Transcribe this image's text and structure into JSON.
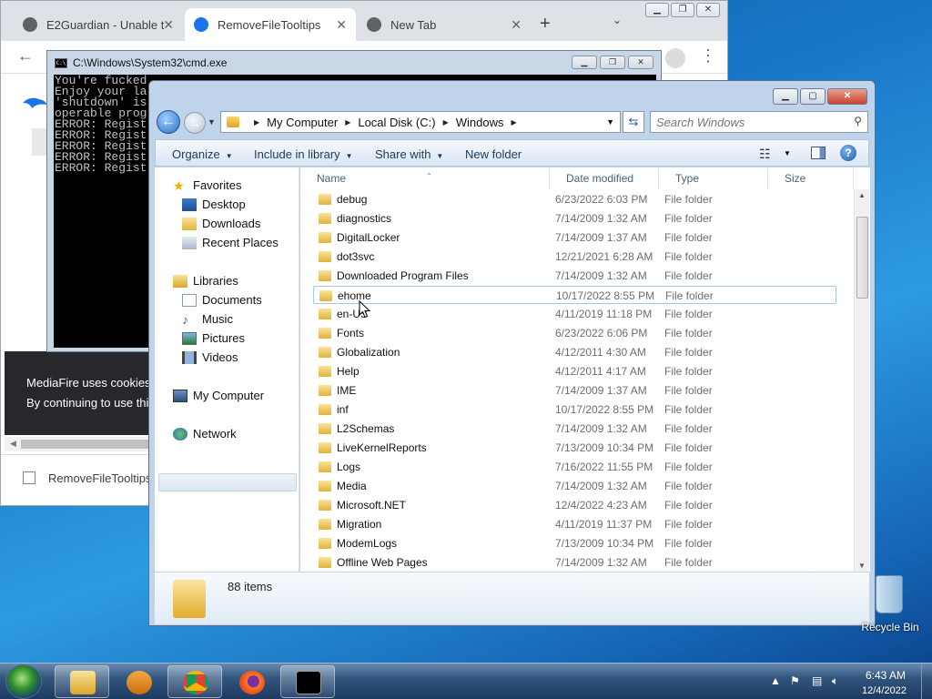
{
  "chrome": {
    "tabs": [
      {
        "label": "E2Guardian - Unable to",
        "active": false
      },
      {
        "label": "RemoveFileTooltips",
        "active": true
      },
      {
        "label": "New Tab",
        "active": false
      }
    ],
    "cookie_line1": "MediaFire uses cookies",
    "cookie_line2": "By continuing to use thi",
    "download_item": "RemoveFileTooltips"
  },
  "cmd": {
    "title": "C:\\Windows\\System32\\cmd.exe",
    "lines": [
      "You're fucked",
      "Enjoy your la",
      "'shutdown' is",
      "operable prog",
      "ERROR: Regist",
      "ERROR: Regist",
      "ERROR: Regist",
      "ERROR: Regist",
      "ERROR: Regist"
    ]
  },
  "explorer": {
    "breadcrumb": [
      "My Computer",
      "Local Disk (C:)",
      "Windows"
    ],
    "search_placeholder": "Search Windows",
    "toolbar": {
      "organize": "Organize",
      "include_in_library": "Include in library",
      "share_with": "Share with",
      "new_folder": "New folder"
    },
    "nav": {
      "favorites": "Favorites",
      "desktop": "Desktop",
      "downloads": "Downloads",
      "recent_places": "Recent Places",
      "libraries": "Libraries",
      "documents": "Documents",
      "music": "Music",
      "pictures": "Pictures",
      "videos": "Videos",
      "my_computer": "My Computer",
      "network": "Network"
    },
    "columns": {
      "name": "Name",
      "date_modified": "Date modified",
      "type": "Type",
      "size": "Size"
    },
    "files": [
      {
        "name": "debug",
        "date": "6/23/2022 6:03 PM",
        "type": "File folder"
      },
      {
        "name": "diagnostics",
        "date": "7/14/2009 1:32 AM",
        "type": "File folder"
      },
      {
        "name": "DigitalLocker",
        "date": "7/14/2009 1:37 AM",
        "type": "File folder"
      },
      {
        "name": "dot3svc",
        "date": "12/21/2021 6:28 AM",
        "type": "File folder"
      },
      {
        "name": "Downloaded Program Files",
        "date": "7/14/2009 1:32 AM",
        "type": "File folder"
      },
      {
        "name": "ehome",
        "date": "10/17/2022 8:55 PM",
        "type": "File folder"
      },
      {
        "name": "en-US",
        "date": "4/11/2019 11:18 PM",
        "type": "File folder"
      },
      {
        "name": "Fonts",
        "date": "6/23/2022 6:06 PM",
        "type": "File folder"
      },
      {
        "name": "Globalization",
        "date": "4/12/2011 4:30 AM",
        "type": "File folder"
      },
      {
        "name": "Help",
        "date": "4/12/2011 4:17 AM",
        "type": "File folder"
      },
      {
        "name": "IME",
        "date": "7/14/2009 1:37 AM",
        "type": "File folder"
      },
      {
        "name": "inf",
        "date": "10/17/2022 8:55 PM",
        "type": "File folder"
      },
      {
        "name": "L2Schemas",
        "date": "7/14/2009 1:32 AM",
        "type": "File folder"
      },
      {
        "name": "LiveKernelReports",
        "date": "7/13/2009 10:34 PM",
        "type": "File folder"
      },
      {
        "name": "Logs",
        "date": "7/16/2022 11:55 PM",
        "type": "File folder"
      },
      {
        "name": "Media",
        "date": "7/14/2009 1:32 AM",
        "type": "File folder"
      },
      {
        "name": "Microsoft.NET",
        "date": "12/4/2022 4:23 AM",
        "type": "File folder"
      },
      {
        "name": "Migration",
        "date": "4/11/2019 11:37 PM",
        "type": "File folder"
      },
      {
        "name": "ModemLogs",
        "date": "7/13/2009 10:34 PM",
        "type": "File folder"
      },
      {
        "name": "Offline Web Pages",
        "date": "7/14/2009 1:32 AM",
        "type": "File folder"
      }
    ],
    "item_count": "88 items"
  },
  "taskbar": {
    "time": "6:43 AM",
    "date": "12/4/2022"
  },
  "desktop": {
    "recycle_bin": "Recycle Bin"
  },
  "colors": {
    "desktop_blue": "#1a78c9",
    "taskbar": "#1c3a61",
    "hover_border": "#a6c6eb",
    "folder_yellow": "#e0b33a"
  }
}
